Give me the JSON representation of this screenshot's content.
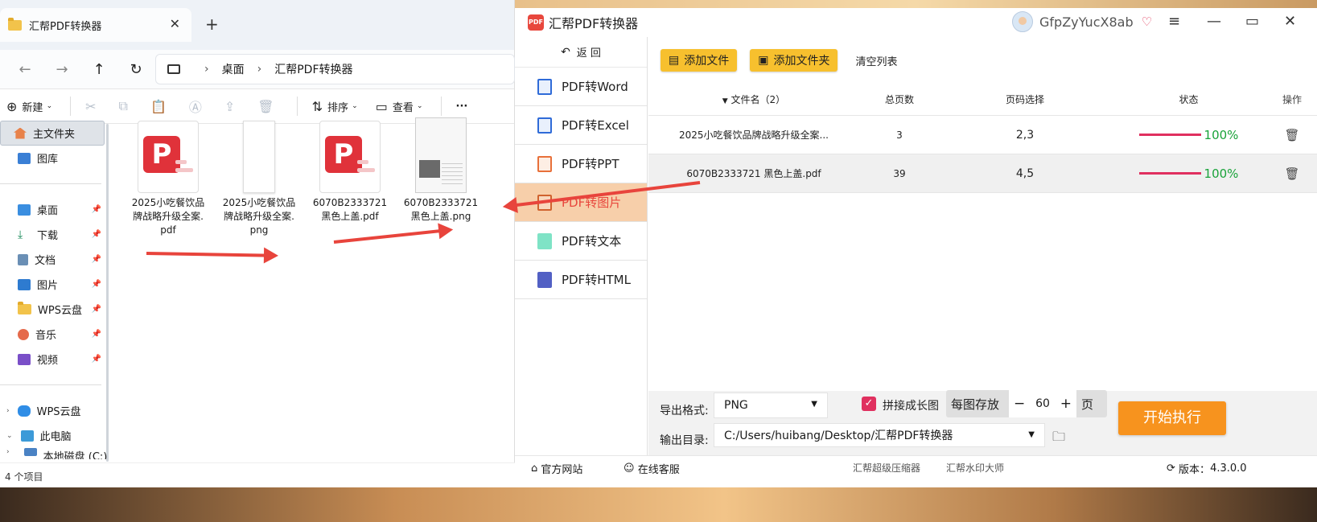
{
  "explorer": {
    "tab_title": "汇帮PDF转换器",
    "tab_close": "✕",
    "new_tab": "+",
    "breadcrumb": [
      "桌面",
      "汇帮PDF转换器"
    ],
    "toolbar": {
      "new": "新建",
      "sort": "排序",
      "view": "查看",
      "more": "···"
    },
    "sidebar": {
      "home": "主文件夹",
      "gallery": "图库",
      "pinned": [
        "桌面",
        "下载",
        "文档",
        "图片",
        "WPS云盘",
        "音乐",
        "视频"
      ],
      "drives": [
        "WPS云盘",
        "此电脑",
        "本地磁盘 (C:)"
      ]
    },
    "files": [
      {
        "line1": "2025小吃餐饮品",
        "line2": "牌战略升级全案.",
        "line3": "pdf"
      },
      {
        "line1": "2025小吃餐饮品",
        "line2": "牌战略升级全案.",
        "line3": "png"
      },
      {
        "line1": "6070B2333721",
        "line2": "黑色上盖.pdf"
      },
      {
        "line1": "6070B2333721",
        "line2": "黑色上盖.png"
      }
    ],
    "status": "4 个项目"
  },
  "app": {
    "title": "汇帮PDF转换器",
    "logo_text": "PDF",
    "username": "GfpZyYucX8ab",
    "back_label": "返  回",
    "nav": [
      "PDF转Word",
      "PDF转Excel",
      "PDF转PPT",
      "PDF转图片",
      "PDF转文本",
      "PDF转HTML"
    ],
    "add_file": "添加文件",
    "add_folder": "添加文件夹",
    "clear_list": "清空列表",
    "columns": {
      "name": "文件名（2）",
      "pages": "总页数",
      "page_select": "页码选择",
      "status": "状态",
      "action": "操作"
    },
    "rows": [
      {
        "name": "2025小吃餐饮品牌战略升级全案...",
        "pages": "3",
        "range": "2,3",
        "progress": "100%"
      },
      {
        "name": "6070B2333721 黑色上盖.pdf",
        "pages": "39",
        "range": "4,5",
        "progress": "100%"
      }
    ],
    "export_format_label": "导出格式:",
    "export_format_value": "PNG",
    "merge_label": "拼接成长图",
    "per_image_label": "每图存放",
    "per_image_minus": "−",
    "per_image_value": "60",
    "per_image_plus": "+",
    "per_image_unit": "页",
    "output_dir_label": "输出目录:",
    "output_dir_value": "C:/Users/huibang/Desktop/汇帮PDF转换器",
    "start_button": "开始执行",
    "footer": {
      "website": "官方网站",
      "support": "在线客服",
      "compressor": "汇帮超级压缩器",
      "watermark": "汇帮水印大师",
      "version_label": "版本：",
      "version": "4.3.0.0"
    }
  },
  "colors": {
    "accent_yellow": "#f7c02e",
    "start_orange": "#f7931e",
    "nav_selected": "#f7cfaa",
    "progress": "#e0305f",
    "percent": "#1aa33a"
  }
}
